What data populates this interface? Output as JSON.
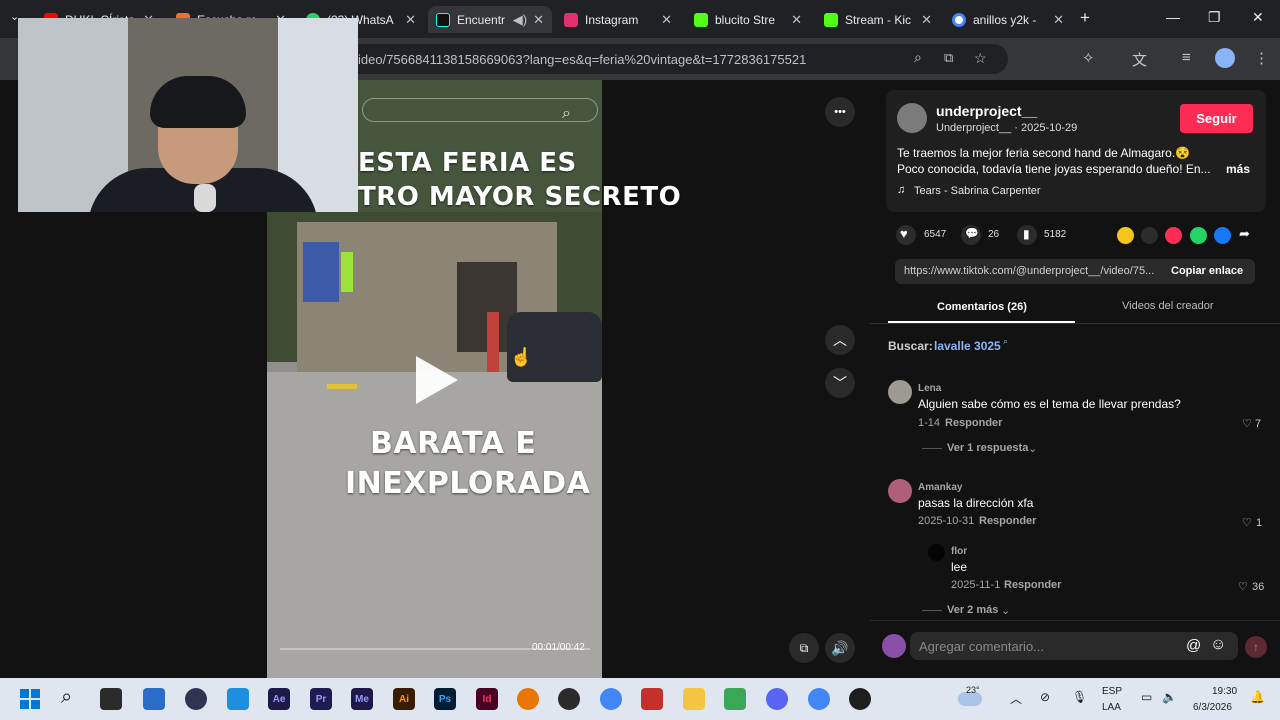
{
  "browser": {
    "tabs": [
      {
        "label": "DUKI, CÍrista",
        "icon": "youtube-icon",
        "color": "#ff0000"
      },
      {
        "label": "Escucha re",
        "icon": "soundcloud-icon",
        "color": "#f26f23"
      },
      {
        "label": "(23) WhatsA",
        "icon": "whatsapp-icon",
        "color": "#25d366"
      },
      {
        "label": "Encuentr",
        "icon": "tiktok-icon",
        "color": "#111111"
      },
      {
        "label": "Instagram",
        "icon": "instagram-icon",
        "color": "#e1306c"
      },
      {
        "label": "blucito Stre",
        "icon": "kick-icon",
        "color": "#53fc18"
      },
      {
        "label": "Stream - Kic",
        "icon": "kick-icon",
        "color": "#53fc18"
      },
      {
        "label": "anillos y2k -",
        "icon": "google-icon",
        "color": "#4285f4"
      }
    ],
    "new_tab": "+",
    "url": "ideo/7566841138158669063?lang=es&q=feria%20vintage&t=1772836175521"
  },
  "video": {
    "caption_top_1": "ESTA FERIA ES",
    "caption_top_2": "TRO MAYOR SECRETO",
    "caption_bottom_1": "BARATA E",
    "caption_bottom_2": "INEXPLORADA",
    "time": "00:01/00:42",
    "more": "•••"
  },
  "creator": {
    "username": "underproject__",
    "subline": "Underproject__ · 2025-10-29",
    "follow_label": "Seguir",
    "description_1": "Te traemos la mejor feria second hand de Almagaro.😵",
    "description_2": "Poco conocida, todavía tiene joyas esperando dueño! En...",
    "more_label": "más",
    "music": "Tears - Sabrina Carpenter"
  },
  "stats": {
    "likes": "6547",
    "comments": "26",
    "saves": "5182"
  },
  "share": {
    "link": "https://www.tiktok.com/@underproject__/video/75...",
    "copy_label": "Copiar enlace"
  },
  "tabs": {
    "comments": "Comentarios (26)",
    "creator_videos": "Videos del creador"
  },
  "search": {
    "label": "Buscar:",
    "term": "lavalle 3025"
  },
  "comments": [
    {
      "user": "Lena",
      "text": "Alguien sabe cómo es el tema de llevar prendas?",
      "date": "1-14",
      "reply": "Responder",
      "likes": "7",
      "replies_label": "Ver 1 respuesta"
    },
    {
      "user": "Amankay",
      "text": "pasas la dirección xfa",
      "date": "2025-10-31",
      "reply": "Responder",
      "likes": "1"
    },
    {
      "user": "flor",
      "text": "lee",
      "date": "2025-11-1",
      "reply": "Responder",
      "likes": "36",
      "replies_label": "Ver 2 más"
    }
  ],
  "comment_box": {
    "placeholder": "Agregar comentario...",
    "mention": "@",
    "emoji": "☺"
  },
  "taskbar": {
    "weather": "23°",
    "lang_1": "ESP",
    "lang_2": "LAA",
    "time": "19:30",
    "date": "6/3/2026",
    "apps": [
      {
        "name": "ae-app",
        "label": "Ae",
        "color": "#1d1a4a"
      },
      {
        "name": "pr-app",
        "label": "Pr",
        "color": "#1f1a4f"
      },
      {
        "name": "me-app",
        "label": "Me",
        "color": "#1d1a4a"
      },
      {
        "name": "ai-app",
        "label": "Ai",
        "color": "#3a1d00"
      },
      {
        "name": "ps-app",
        "label": "Ps",
        "color": "#001d34"
      },
      {
        "name": "id-app",
        "label": "Id",
        "color": "#49021f"
      }
    ]
  }
}
